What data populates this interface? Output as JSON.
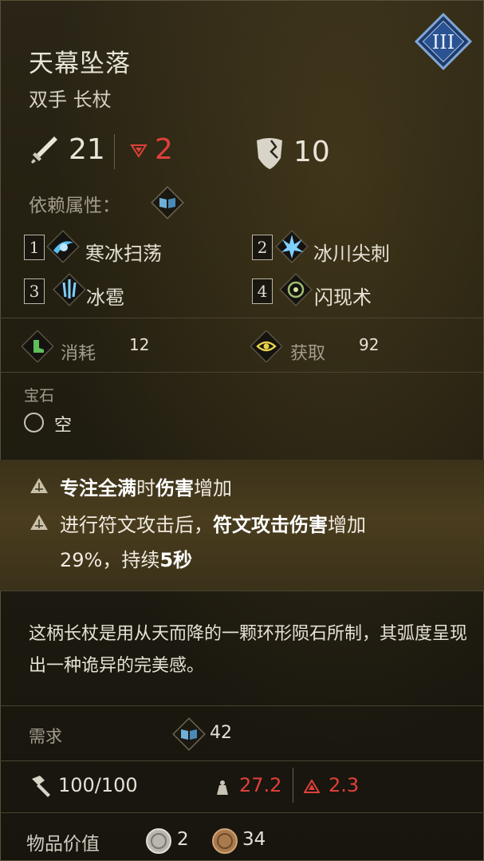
{
  "item": {
    "name": "天幕坠落",
    "type": "双手 长杖",
    "tier": "III"
  },
  "stats": {
    "attack": "21",
    "attack_diff": "2",
    "defense": "10"
  },
  "dependency": {
    "label": "依赖属性："
  },
  "skills": [
    {
      "num": "1",
      "name": "寒冰扫荡"
    },
    {
      "num": "2",
      "name": "冰川尖刺"
    },
    {
      "num": "3",
      "name": "冰雹"
    },
    {
      "num": "4",
      "name": "闪现术"
    }
  ],
  "resources": {
    "consume_label": "消耗",
    "consume_value": "12",
    "gain_label": "获取",
    "gain_value": "92"
  },
  "gem": {
    "label": "宝石",
    "slot": "空"
  },
  "effects": {
    "line1": {
      "a": "专注全满",
      "b": "时",
      "c": "伤害",
      "d": "增加"
    },
    "line2": {
      "a": "进行符文攻击后，",
      "b": "符文攻击伤害",
      "c": "增加"
    },
    "line3": {
      "a": "29%，持续",
      "b": "5秒"
    }
  },
  "description": "这柄长杖是用从天而降的一颗环形陨石所制，其弧度呈现出一种诡异的完美感。",
  "requirements": {
    "label": "需求",
    "value": "42"
  },
  "durability": {
    "value": "100/100"
  },
  "weight": {
    "value": "27.2",
    "delta": "2.3"
  },
  "value": {
    "label": "物品价值",
    "silver": "2",
    "copper": "34"
  },
  "colors": {
    "accent_red": "#e0403a",
    "gold": "#d9c96a",
    "green": "#5fbf5a"
  }
}
